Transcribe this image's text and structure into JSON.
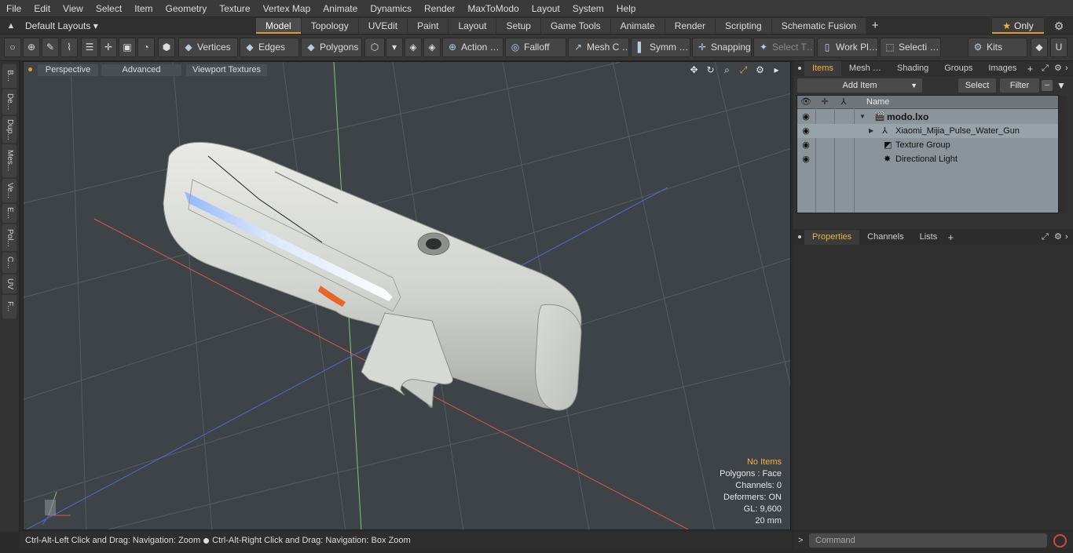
{
  "menu": [
    "File",
    "Edit",
    "View",
    "Select",
    "Item",
    "Geometry",
    "Texture",
    "Vertex Map",
    "Animate",
    "Dynamics",
    "Render",
    "MaxToModo",
    "Layout",
    "System",
    "Help"
  ],
  "layout_bar": {
    "layouts_label": "Default Layouts ▾",
    "tabs": [
      "Model",
      "Topology",
      "UVEdit",
      "Paint",
      "Layout",
      "Setup",
      "Game Tools",
      "Animate",
      "Render",
      "Scripting",
      "Schematic Fusion"
    ],
    "active_tab": "Model",
    "add_tab": "+",
    "only_label": "Only"
  },
  "toolbar": {
    "vertices": "Vertices",
    "edges": "Edges",
    "polygons": "Polygons",
    "action": "Action …",
    "falloff": "Falloff",
    "mesh_c": "Mesh C …",
    "symm": "Symm …",
    "snapping": "Snapping",
    "select_t": "Select T…",
    "work_pl": "Work Pl…",
    "selecti": "Selecti …",
    "kits": "Kits"
  },
  "left_tabs": [
    "B...",
    "De...",
    "Dup...",
    "Mes...",
    "Ve...",
    "E...",
    "Pol...",
    "C...",
    "UV",
    "F..."
  ],
  "viewport": {
    "perspective": "Perspective",
    "advanced": "Advanced",
    "viewport_textures": "Viewport Textures",
    "stats": {
      "no_items": "No Items",
      "polygons": "Polygons : Face",
      "channels": "Channels: 0",
      "deformers": "Deformers: ON",
      "gl": "GL: 9,600",
      "unit": "20 mm"
    }
  },
  "statusbar": {
    "hint1": "Ctrl-Alt-Left Click and Drag: Navigation: Zoom",
    "hint2": "Ctrl-Alt-Right Click and Drag: Navigation: Box Zoom"
  },
  "items_panel": {
    "tabs": [
      "Items",
      "Mesh …",
      "Shading",
      "Groups",
      "Images"
    ],
    "active_tab": "Items",
    "add_item": "Add Item",
    "select": "Select",
    "filter": "Filter",
    "name_header": "Name",
    "tree": [
      {
        "label": "modo.lxo",
        "depth": 0,
        "icon": "scene-icon"
      },
      {
        "label": "Xiaomi_Mijia_Pulse_Water_Gun",
        "depth": 1,
        "icon": "mesh-icon"
      },
      {
        "label": "Texture Group",
        "depth": 1,
        "icon": "texture-group-icon"
      },
      {
        "label": "Directional Light",
        "depth": 1,
        "icon": "light-icon"
      }
    ]
  },
  "properties_panel": {
    "tabs": [
      "Properties",
      "Channels",
      "Lists"
    ],
    "active_tab": "Properties"
  },
  "command": {
    "placeholder": "Command"
  },
  "colors": {
    "accent": "#e59a2f",
    "highlight_text": "#f3b440",
    "viewport_bg": "#3e4347",
    "tree_bg": "#8b949b"
  }
}
